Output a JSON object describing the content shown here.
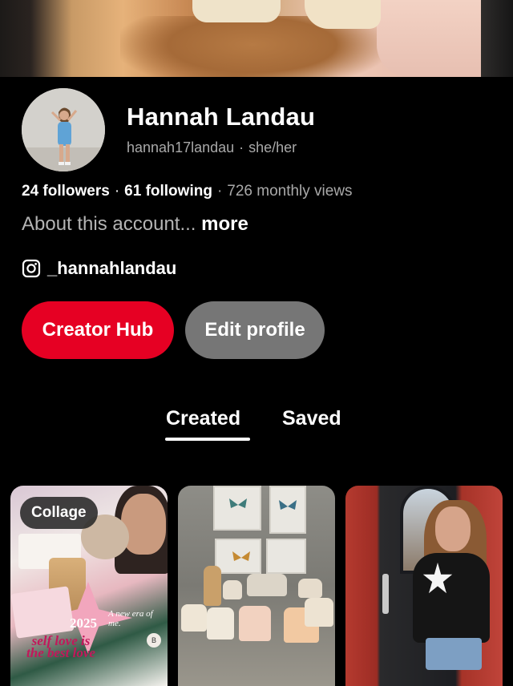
{
  "profile": {
    "name": "Hannah Landau",
    "username": "hannah17landau",
    "separator": "·",
    "pronouns": "she/her",
    "followers": "24 followers",
    "following": "61 following",
    "monthly_views": "726 monthly views",
    "about_text": "About this account...",
    "about_more": "more",
    "instagram_handle": "_hannahlandau"
  },
  "actions": {
    "creator_hub": "Creator Hub",
    "edit_profile": "Edit profile"
  },
  "tabs": [
    {
      "label": "Created",
      "active": true
    },
    {
      "label": "Saved",
      "active": false
    }
  ],
  "pins": [
    {
      "badge": "Collage",
      "texts": {
        "new_era": "A new era of me.",
        "year": "2025",
        "self_love": "self love is the best love",
        "b": "B"
      }
    },
    {
      "badge": ""
    },
    {
      "badge": ""
    }
  ],
  "colors": {
    "background": "#000000",
    "accent_red": "#e60023",
    "secondary_button": "#767676",
    "muted_text": "#a9a9a9"
  },
  "icons": {
    "instagram": "instagram-icon"
  }
}
